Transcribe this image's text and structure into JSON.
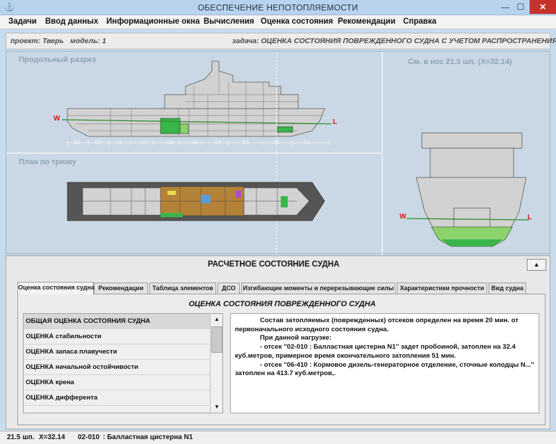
{
  "window": {
    "title": "ОБЕСПЕЧЕНИЕ НЕПОТОПЛЯЕМОСТИ",
    "minimize": "—",
    "maximize": "☐",
    "close": "✕",
    "app_icon": "ship-icon"
  },
  "menu": [
    "Задачи",
    "Ввод данных",
    "Информационные окна",
    "Вычисления",
    "Оценка состояния",
    "Рекомендации",
    "Справка"
  ],
  "info": {
    "project": "проект: Тверь",
    "model": "модель: 1",
    "task": "задача: ОЦЕНКА СОСТОЯНИЯ ПОВРЕЖДЕННОГО СУДНА С УЧЕТОМ РАСПРОСТРАНЕНИЯ ВОДЫ"
  },
  "views": {
    "profile_label": "Продольный разрез",
    "plan_label": "План по трюму",
    "section_label": "См. в нос  21.5 шп.  (X=32.14)",
    "waterline_left": "W",
    "waterline_right": "L",
    "frame_labels": [
      "10",
      "09",
      "08",
      "07",
      "06",
      "05",
      "04",
      "03",
      "02",
      "01"
    ]
  },
  "bottom": {
    "title": "РАСЧЕТНОЕ СОСТОЯНИЕ СУДНА",
    "collapse_icon": "▲",
    "tabs": [
      "Оценка состояния судна",
      "Рекомендации",
      "Таблица элементов",
      "ДСО",
      "Изгибающие моменты и перерезывающие силы",
      "Характеристики прочности",
      "Вид судна"
    ],
    "panel_title": "ОЦЕНКА СОСТОЯНИЯ ПОВРЕЖДЕННОГО СУДНА",
    "list": [
      "ОБЩАЯ ОЦЕНКА СОСТОЯНИЯ СУДНА",
      "ОЦЕНКА стабильности",
      "ОЦЕНКА запаса плавучести",
      "ОЦЕНКА начальной остойчивости",
      "ОЦЕНКА крена",
      "ОЦЕНКА дифферента"
    ],
    "scroll_up": "▲",
    "scroll_down": "▼",
    "text": {
      "p1": "Состав затопляемых (поврежденных) отсеков определен на время 20 мин. от первоначального исходного состояния судна.",
      "p2": "При данной нагрузке:",
      "p3": "- отсек ''02-010 : Балластная цистерна N1'' задет пробоиной, затоплен на 32.4 куб.метров, примерное время окончательного затопления 51 мин.",
      "p4": "- отсек ''06-410 : Кормовое дизель-генераторное отделение, сточные колодцы N...'' затоплен на 413.7 куб.метров,."
    }
  },
  "status": {
    "frame": "21.5 шп.",
    "x": "X=32.14",
    "compartment": "02-010",
    "name": ": Балластная цистерна  N1"
  },
  "colors": {
    "flooded": "#39b54a",
    "flooded_light": "#8bd36a",
    "hull": "#d2d2d2",
    "deck_wood": "#b38238",
    "waterline": "#2e8b2e",
    "close": "#c7312b"
  }
}
